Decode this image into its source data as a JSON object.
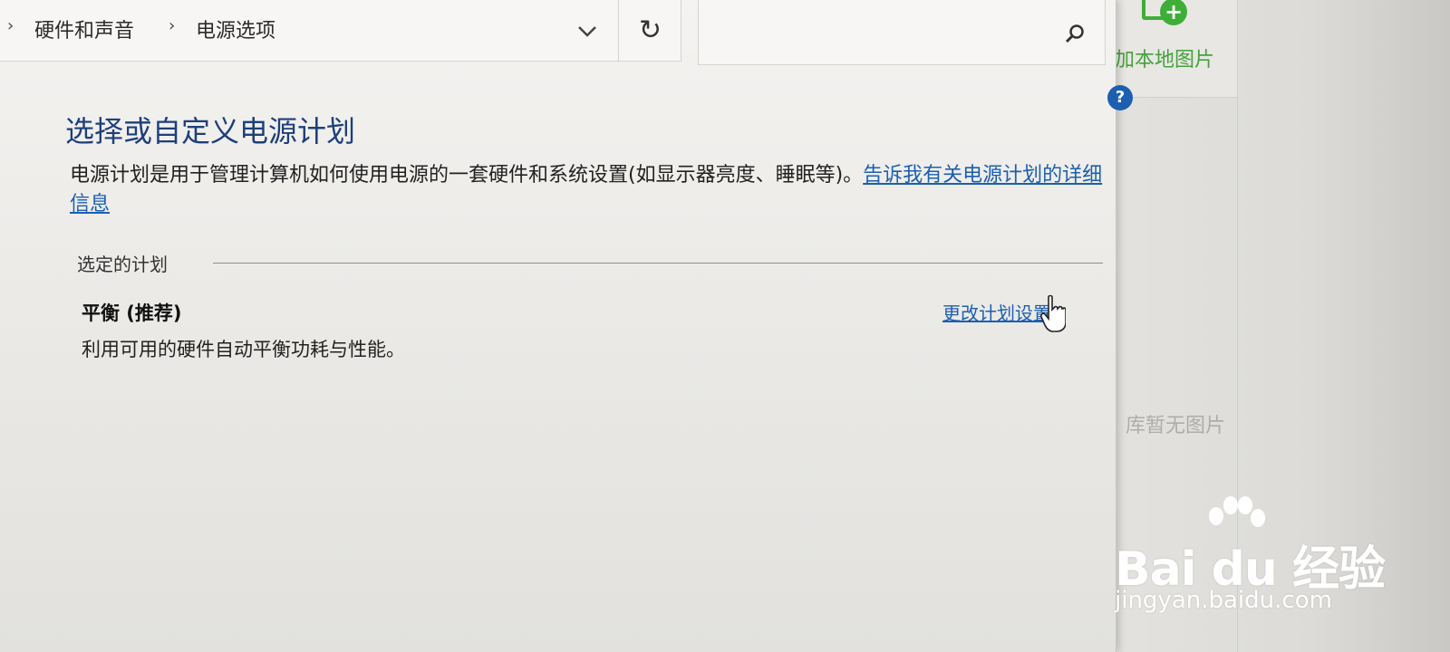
{
  "background_app": {
    "add_label": "加本地图片",
    "empty_label": "库暂无图片"
  },
  "breadcrumb": {
    "items": [
      "硬件和声音",
      "电源选项"
    ]
  },
  "page": {
    "title": "选择或自定义电源计划",
    "description": "电源计划是用于管理计算机如何使用电源的一套硬件和系统设置(如显示器亮度、睡眠等)。",
    "learn_more_link": "告诉我有关电源计划的详细信息"
  },
  "selected_plan": {
    "section_label": "选定的计划",
    "name": "平衡 (推荐)",
    "description": "利用可用的硬件自动平衡功耗与性能。",
    "change_link": "更改计划设置"
  },
  "watermark": {
    "logo_text": "Bai du 经验",
    "url": "jingyan.baidu.com"
  },
  "icons": {
    "help": "help-icon",
    "search": "search-icon",
    "refresh": "refresh-icon",
    "dropdown": "chevron-down-icon"
  },
  "colors": {
    "title_blue": "#1e3f7a",
    "link_blue": "#1c5fb0",
    "accent_green": "#3fae38"
  }
}
